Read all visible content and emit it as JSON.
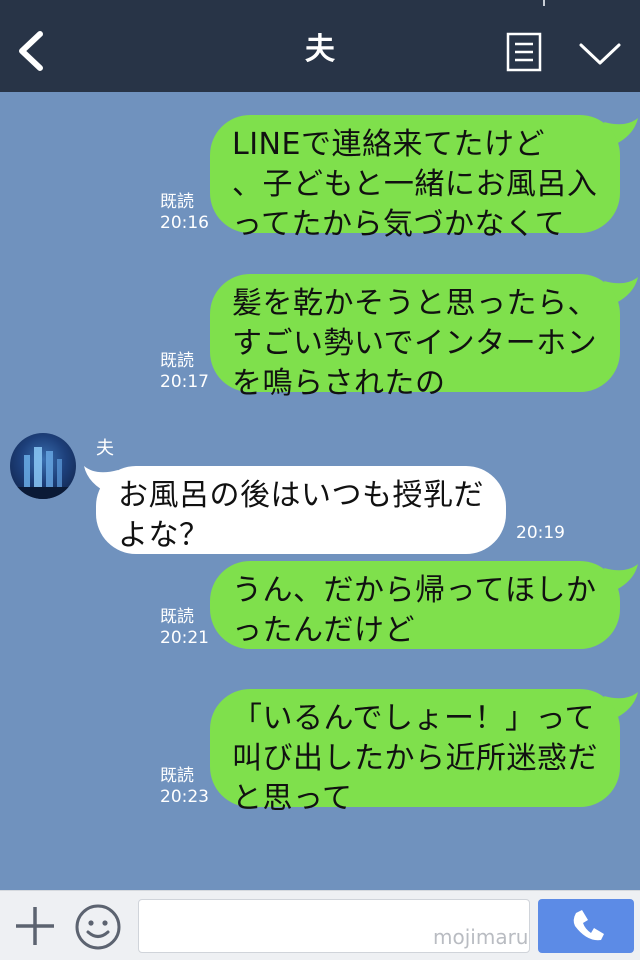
{
  "header": {
    "title": "夫",
    "back_icon": "chevron-left-icon",
    "note_icon": "note-icon",
    "menu_icon": "chevron-down-icon"
  },
  "messages": [
    {
      "side": "out",
      "text": "LINEで連絡来てたけど\n、子どもと一緒にお風呂入\nってたから気づかなくて",
      "read": "既読",
      "time": "20:16"
    },
    {
      "side": "out",
      "text": "髪を乾かそうと思ったら、\nすごい勢いでインターホン\nを鳴らされたの",
      "read": "既読",
      "time": "20:17"
    },
    {
      "side": "in",
      "sender": "夫",
      "text": "お風呂の後はいつも授乳だ\nよな？",
      "time": "20:19"
    },
    {
      "side": "out",
      "text": "うん、だから帰ってほしか\nったんだけど",
      "read": "既読",
      "time": "20:21"
    },
    {
      "side": "out",
      "text": "「いるんでしょー！」って\n叫び出したから近所迷惑だ\nと思って",
      "read": "既読",
      "time": "20:23"
    }
  ],
  "input": {
    "placeholder": "",
    "watermark": "mojimaru"
  },
  "colors": {
    "background": "#7092be",
    "header": "#283447",
    "outgoing_bubble": "#7fe04c",
    "incoming_bubble": "#ffffff",
    "call_button": "#5c8be6"
  }
}
